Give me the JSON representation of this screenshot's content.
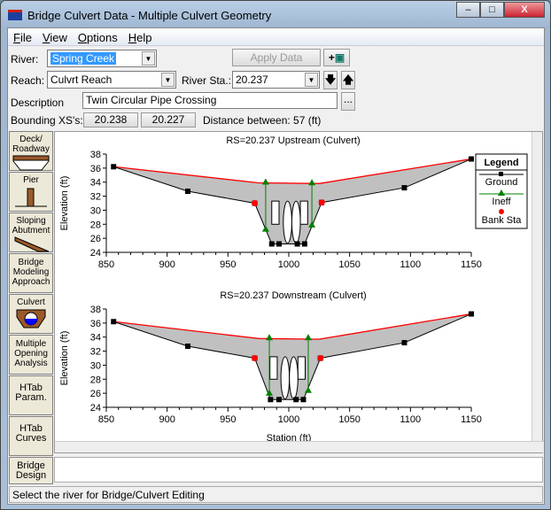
{
  "window": {
    "title": "Bridge Culvert Data - Multiple Culvert Geometry",
    "minimize": "0",
    "maximize": "1",
    "close": "X"
  },
  "menu": [
    "File",
    "View",
    "Options",
    "Help"
  ],
  "form": {
    "river_label": "River:",
    "river": "Spring Creek",
    "reach_label": "Reach:",
    "reach": "Culvrt Reach",
    "river_sta_label": "River Sta.:",
    "river_sta": "20.237",
    "apply": "Apply Data",
    "description_label": "Description",
    "description": "Twin Circular Pipe Crossing",
    "more": "...",
    "bounding_label": "Bounding XS's:",
    "bounding_up": "20.238",
    "bounding_down": "20.227",
    "distance": "Distance between: 57 (ft)"
  },
  "sidebar": [
    {
      "label": "Deck/ Roadway",
      "icon": "deck-icon"
    },
    {
      "label": "Pier",
      "icon": "pier-icon"
    },
    {
      "label": "Sloping Abutment",
      "icon": "abutment-icon"
    },
    {
      "label": "Bridge Modeling Approach"
    },
    {
      "label": "Culvert",
      "icon": "culvert-icon"
    },
    {
      "label": "Multiple Opening Analysis"
    },
    {
      "label": "HTab Param."
    },
    {
      "label": "HTab Curves"
    },
    {
      "label": "Bridge Design"
    }
  ],
  "status": "Select the river for Bridge/Culvert Editing",
  "colors": {
    "ground": "#000000",
    "deck": "#ff0000",
    "ineff": "#008000",
    "bank": "#ff0000",
    "fill": "#c0c0c0"
  },
  "chart_data": [
    {
      "type": "line",
      "title": "RS=20.237  Upstream  (Culvert)",
      "ylabel": "Elevation (ft)",
      "xlabel": "",
      "xlim": [
        850,
        1150
      ],
      "ylim": [
        24,
        38
      ],
      "xticks": [
        850,
        900,
        950,
        1000,
        1050,
        1100,
        1150
      ],
      "yticks": [
        24,
        26,
        28,
        30,
        32,
        34,
        36,
        38
      ],
      "legend": {
        "title": "Legend",
        "entries": [
          "Ground",
          "Ineff",
          "Bank Sta"
        ],
        "placement": "right"
      },
      "ground": [
        [
          856,
          36.2
        ],
        [
          917,
          32.7
        ],
        [
          972,
          31.0
        ],
        [
          986,
          25.2
        ],
        [
          992,
          25.2
        ],
        [
          1007,
          25.2
        ],
        [
          1013,
          25.2
        ],
        [
          1027,
          31.1
        ],
        [
          1095,
          33.2
        ],
        [
          1150,
          37.3
        ]
      ],
      "deck": [
        [
          856,
          36.2
        ],
        [
          975,
          33.9
        ],
        [
          1025,
          33.8
        ],
        [
          1150,
          37.3
        ]
      ],
      "ineff": [
        [
          [
            981,
            27.2
          ],
          [
            981,
            33.9
          ]
        ],
        [
          [
            1019,
            27.8
          ],
          [
            1019,
            33.8
          ]
        ]
      ],
      "bank": [
        [
          972,
          31.0
        ],
        [
          1027,
          31.1
        ]
      ],
      "culverts": [
        [
          995.5,
          1002.5,
          25.3,
          31.3
        ],
        [
          1002.5,
          1009.5,
          25.3,
          31.3
        ]
      ],
      "boxes": [
        [
          986,
          992,
          28.0,
          31.3
        ],
        [
          1009.5,
          1015.5,
          28.0,
          31.3
        ]
      ]
    },
    {
      "type": "line",
      "title": "RS=20.237  Downstream  (Culvert)",
      "ylabel": "Elevation (ft)",
      "xlabel": "Station (ft)",
      "xlim": [
        850,
        1150
      ],
      "ylim": [
        24,
        38
      ],
      "xticks": [
        850,
        900,
        950,
        1000,
        1050,
        1100,
        1150
      ],
      "yticks": [
        24,
        26,
        28,
        30,
        32,
        34,
        36,
        38
      ],
      "ground": [
        [
          856,
          36.2
        ],
        [
          917,
          32.7
        ],
        [
          972,
          31.0
        ],
        [
          985,
          25.1
        ],
        [
          992,
          25.1
        ],
        [
          1006,
          25.1
        ],
        [
          1012,
          25.1
        ],
        [
          1026,
          31.0
        ],
        [
          1095,
          33.2
        ],
        [
          1150,
          37.3
        ]
      ],
      "deck": [
        [
          856,
          36.2
        ],
        [
          975,
          33.8
        ],
        [
          1025,
          33.7
        ],
        [
          1150,
          37.3
        ]
      ],
      "ineff": [
        [
          [
            984,
            25.9
          ],
          [
            984,
            33.8
          ]
        ],
        [
          [
            1016,
            26.3
          ],
          [
            1016,
            33.8
          ]
        ]
      ],
      "bank": [
        [
          972,
          31.0
        ],
        [
          1026,
          31.0
        ]
      ],
      "culverts": [
        [
          993.5,
          1000.5,
          25.2,
          31.2
        ],
        [
          1000.5,
          1007.5,
          25.2,
          31.2
        ]
      ],
      "boxes": [
        [
          984.5,
          990.5,
          28.0,
          31.2
        ],
        [
          1007.5,
          1013.5,
          28.0,
          31.2
        ]
      ]
    }
  ]
}
